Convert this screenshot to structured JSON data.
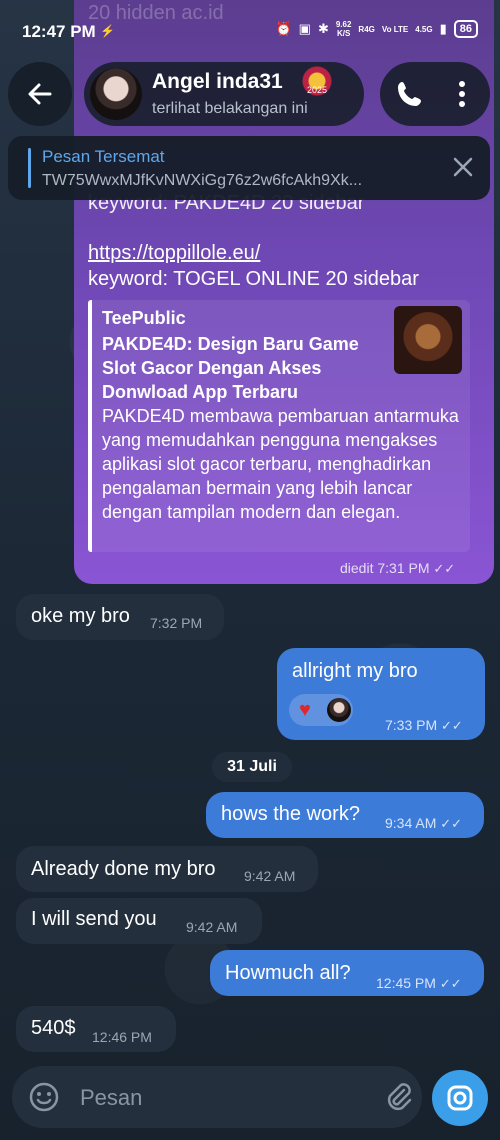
{
  "status_bar": {
    "time": "12:47 PM",
    "speed": "9.62",
    "speed_unit": "K/S",
    "network": "R4G",
    "lte": "Vo LTE",
    "net2": "4.5G",
    "battery": "86",
    "faded_behind": "20 hidden ac.id"
  },
  "header": {
    "name": "Angel inda31",
    "status": "terlihat belakangan ini",
    "badge_text": "2025"
  },
  "pinned": {
    "title": "Pesan Tersemat",
    "text": "TW75WwxMJfKvNWXiGg76z2w6fcAkh9Xk..."
  },
  "promo_message": {
    "clipped_line": "keyword: PAKDE4D 20 sidebar",
    "link": "https://toppillole.eu/",
    "keyword": "keyword: TOGEL ONLINE 20 sidebar",
    "preview_site": "TeePublic",
    "preview_title": "PAKDE4D: Design Baru Game Slot Gacor Dengan Akses Donwload App Terbaru",
    "preview_desc": "PAKDE4D membawa pembaruan antarmuka yang memudahkan pengguna mengakses aplikasi slot gacor terbaru, menghadirkan pengalaman bermain yang lebih lancar dengan tampilan modern dan elegan.",
    "meta": "diedit 7:31 PM"
  },
  "messages": [
    {
      "text": "oke my bro",
      "time": "7:32 PM",
      "dir": "in"
    },
    {
      "text": "allright my bro",
      "time": "7:33 PM",
      "dir": "out",
      "reaction": "heart"
    },
    {
      "text": "hows the work?",
      "time": "9:34 AM",
      "dir": "out"
    },
    {
      "text": "Already done my bro",
      "time": "9:42 AM",
      "dir": "in"
    },
    {
      "text": "I will  send you",
      "time": "9:42 AM",
      "dir": "in"
    },
    {
      "text": "Howmuch all?",
      "time": "12:45 PM",
      "dir": "out"
    },
    {
      "text": "540$",
      "time": "12:46 PM",
      "dir": "in"
    }
  ],
  "date_separator": "31 Juli",
  "input": {
    "placeholder": "Pesan"
  },
  "colors": {
    "accent": "#3a9ee8",
    "outgoing": "#3d7bd9",
    "incoming": "#232f3c",
    "pinned_title": "#5ea7ea"
  }
}
